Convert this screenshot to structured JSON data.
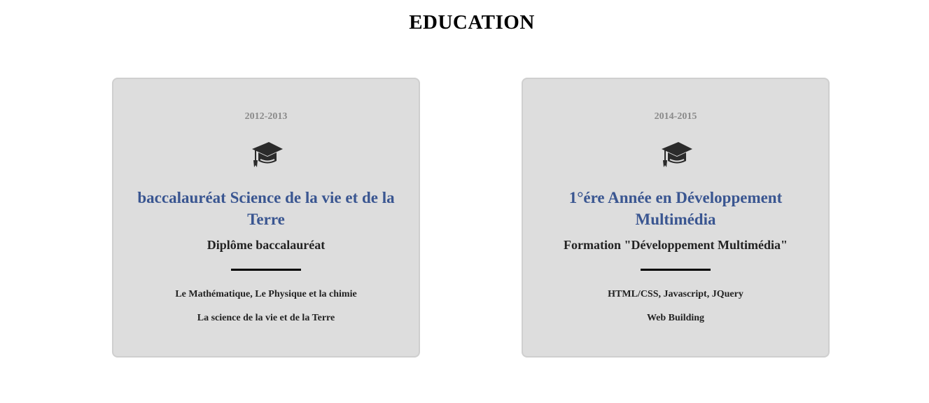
{
  "section": {
    "title": "EDUCATION"
  },
  "cards": [
    {
      "years": "2012-2013",
      "icon": "graduation-cap-icon",
      "degree": "baccalauréat Science de la vie et de la Terre",
      "diploma": "Diplôme baccalauréat",
      "courses": [
        "Le Mathématique, Le Physique et la chimie",
        "La science de la vie et de la Terre"
      ]
    },
    {
      "years": "2014-2015",
      "icon": "graduation-cap-icon",
      "degree": "1°ére Année en Développement Multimédia",
      "diploma": "Formation \"Développement Multimédia\"",
      "courses": [
        "HTML/CSS, Javascript, JQuery",
        "Web Building"
      ]
    }
  ],
  "colors": {
    "card_background": "#dddddd",
    "card_border": "#cfcfcf",
    "degree_text": "#3a5691",
    "years_text": "#8a8a8a",
    "divider": "#000000"
  }
}
